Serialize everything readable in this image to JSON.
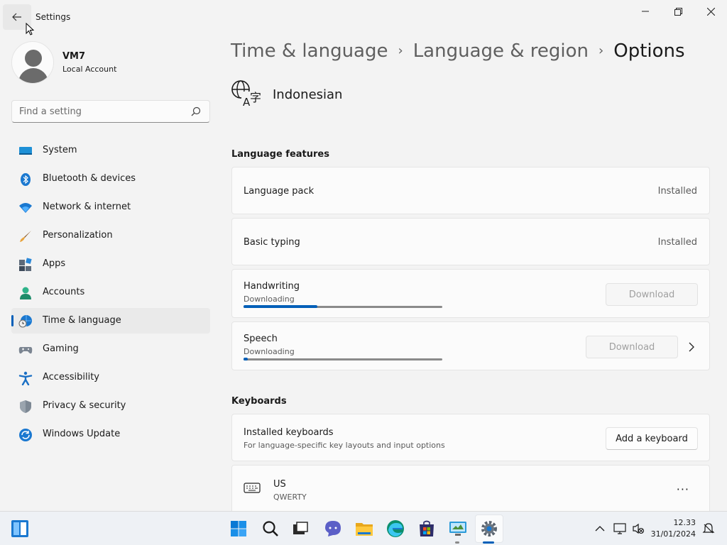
{
  "window": {
    "title": "Settings",
    "back_icon": "arrow-left-icon",
    "controls": [
      "minimize-icon",
      "restore-icon",
      "close-icon"
    ]
  },
  "profile": {
    "name": "VM7",
    "account_type": "Local Account"
  },
  "search": {
    "placeholder": "Find a setting",
    "value": ""
  },
  "sidebar": {
    "items": [
      {
        "label": "System",
        "icon": "system-icon",
        "active": false
      },
      {
        "label": "Bluetooth & devices",
        "icon": "bluetooth-icon",
        "active": false
      },
      {
        "label": "Network & internet",
        "icon": "wifi-icon",
        "active": false
      },
      {
        "label": "Personalization",
        "icon": "brush-icon",
        "active": false
      },
      {
        "label": "Apps",
        "icon": "apps-icon",
        "active": false
      },
      {
        "label": "Accounts",
        "icon": "accounts-icon",
        "active": false
      },
      {
        "label": "Time & language",
        "icon": "globe-clock-icon",
        "active": true
      },
      {
        "label": "Gaming",
        "icon": "gamepad-icon",
        "active": false
      },
      {
        "label": "Accessibility",
        "icon": "accessibility-icon",
        "active": false
      },
      {
        "label": "Privacy & security",
        "icon": "shield-icon",
        "active": false
      },
      {
        "label": "Windows Update",
        "icon": "update-icon",
        "active": false
      }
    ]
  },
  "breadcrumb": {
    "items": [
      "Time & language",
      "Language & region",
      "Options"
    ]
  },
  "language": {
    "icon": "language-icon",
    "name": "Indonesian"
  },
  "language_features": {
    "title": "Language features",
    "items": [
      {
        "title": "Language pack",
        "status": "Installed"
      },
      {
        "title": "Basic typing",
        "status": "Installed"
      },
      {
        "title": "Handwriting",
        "sub": "Downloading",
        "button": "Download",
        "progress": 0.37
      },
      {
        "title": "Speech",
        "sub": "Downloading",
        "button": "Download",
        "progress": 0.01
      }
    ]
  },
  "keyboards": {
    "title": "Keyboards",
    "installed": {
      "title": "Installed keyboards",
      "sub": "For language-specific key layouts and input options",
      "button": "Add a keyboard"
    },
    "list": [
      {
        "name": "US",
        "layout": "QWERTY",
        "icon": "keyboard-icon",
        "more": "···"
      }
    ]
  },
  "taskbar": {
    "icons": [
      "widgets-icon",
      "start-icon",
      "search-icon",
      "task-view-icon",
      "chat-icon",
      "file-explorer-icon",
      "edge-icon",
      "store-icon",
      "remote-desktop-icon",
      "settings-icon"
    ],
    "tray": [
      "chevron-up-icon",
      "network-icon",
      "volume-muted-icon",
      "notification-icon"
    ],
    "time": "12.33",
    "date": "31/01/2024"
  },
  "colors": {
    "accent": "#005fb8",
    "background": "#f3f3f3",
    "card": "#fbfbfb"
  }
}
